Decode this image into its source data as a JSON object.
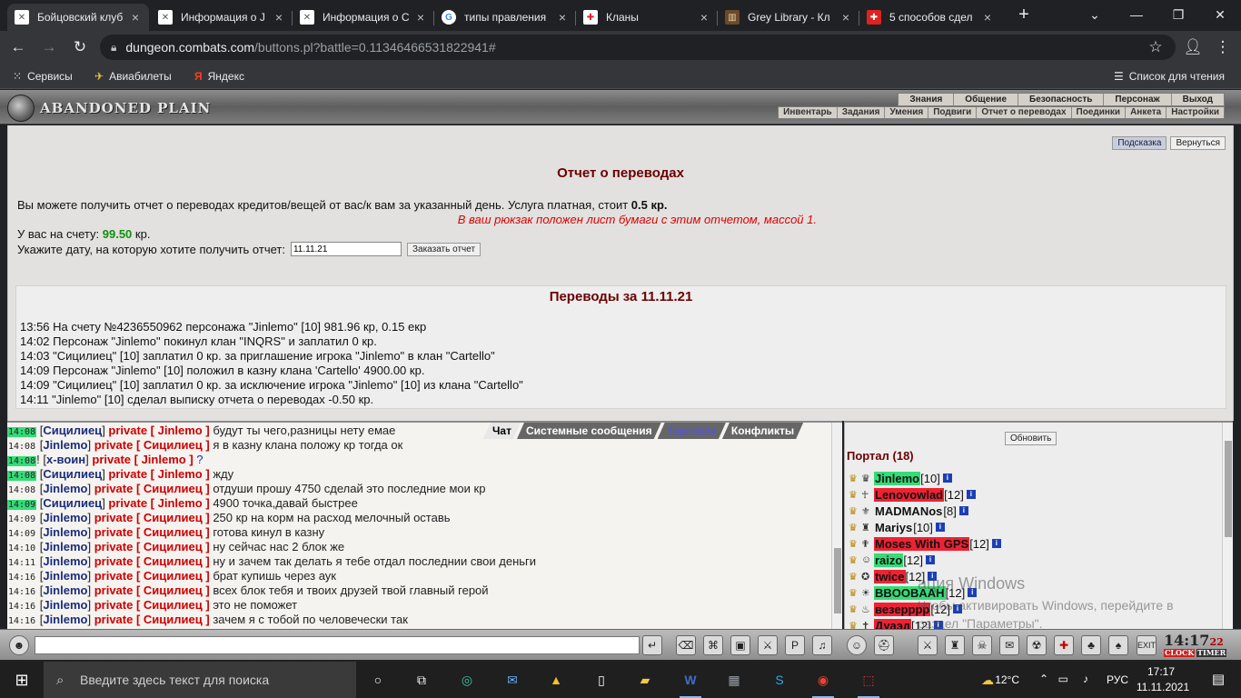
{
  "browser": {
    "tabs": [
      {
        "title": "Бойцовский клуб",
        "favicon": "x-logo-icon",
        "active": true
      },
      {
        "title": "Информация о J",
        "favicon": "x-logo-icon"
      },
      {
        "title": "Информация о С",
        "favicon": "x-logo-icon"
      },
      {
        "title": "типы правления",
        "favicon": "google-icon"
      },
      {
        "title": "Кланы",
        "favicon": "shield-icon"
      },
      {
        "title": "Grey Library - Кл",
        "favicon": "library-icon"
      },
      {
        "title": "5 способов сдел",
        "favicon": "bookmark-icon"
      }
    ],
    "new_tab": "+",
    "url_host": "dungeon.combats.com",
    "url_rest": "/buttons.pl?battle=0.11346466531822941#",
    "bookmarks": [
      {
        "label": "Сервисы",
        "icon": "apps-grid-icon"
      },
      {
        "label": "Авиабилеты",
        "icon": "plane-icon"
      },
      {
        "label": "Яндекс",
        "icon": "yandex-icon"
      }
    ],
    "reading_list": "Список для чтения"
  },
  "game_header": {
    "logo_text": "ABANDONED PLAIN",
    "menu_top": [
      "Знания",
      "Общение",
      "Безопасность",
      "Персонаж",
      "Выход"
    ],
    "menu_sub": [
      "Инвентарь",
      "Задания",
      "Умения",
      "Подвиги",
      "Отчет о переводах",
      "Поединки",
      "Анкета",
      "Настройки"
    ]
  },
  "page": {
    "hint_button": "Подсказка",
    "back_button": "Вернуться",
    "title": "Отчет о переводах",
    "desc_prefix": "Вы можете получить отчет о переводах кредитов/вещей от вас/к вам за указанный день. Услуга платная, стоит ",
    "desc_price": "0.5 кр.",
    "notice": "В ваш рюкзак положен лист бумаги с этим отчетом, массой 1.",
    "balance_label": "У вас на счету: ",
    "balance_value": "99.50",
    "balance_unit": " кр.",
    "date_label": "Укажите дату, на которую хотите получить отчет:",
    "date_value": "11.11.21",
    "order_button": "Заказать отчет",
    "report_title": "Переводы за 11.11.21",
    "report_lines": [
      "13:56 На счету №4236550962 персонажа \"Jinlemo\" [10] 981.96 кр, 0.15 екр",
      "14:02 Персонаж \"Jinlemo\" покинул клан \"INQRS\" и заплатил 0 кр.",
      "14:03 \"Сицилиец\" [10] заплатил 0 кр. за приглашение игрока \"Jinlemo\" в клан \"Cartello\"",
      "14:09 Персонаж \"Jinlemo\" [10] положил в казну клана 'Cartello' 4900.00 кр.",
      "14:09 \"Сицилиец\" [10] заплатил 0 кр. за исключение игрока \"Jinlemo\" [10] из клана \"Cartello\"",
      "14:11 \"Jinlemo\" [10] сделал выписку отчета о переводах -0.50 кр."
    ]
  },
  "chat": {
    "tabs": [
      "Чат",
      "Системные сообщения",
      "Торговля",
      "Конфликты"
    ],
    "messages": [
      {
        "time": "14:08",
        "hl": true,
        "from": "Сицилиец",
        "to": "Jinlemo",
        "text": "будут ты чего,разницы нету емае"
      },
      {
        "time": "14:08",
        "hl": false,
        "from": "Jinlemo",
        "to": "Сицилиец",
        "text": "я в казну клана положу кр тогда ок"
      },
      {
        "time": "14:08",
        "hl": true,
        "from": "x-воин",
        "to": "Jinlemo",
        "text": "?",
        "bang": true
      },
      {
        "time": "14:08",
        "hl": true,
        "from": "Сицилиец",
        "to": "Jinlemo",
        "text": "жду"
      },
      {
        "time": "14:08",
        "hl": false,
        "from": "Jinlemo",
        "to": "Сицилиец",
        "text": "отдуши прошу 4750 сделай это последние мои кр"
      },
      {
        "time": "14:09",
        "hl": true,
        "from": "Сицилиец",
        "to": "Jinlemo",
        "text": "4900 точка,давай быстрее"
      },
      {
        "time": "14:09",
        "hl": false,
        "from": "Jinlemo",
        "to": "Сицилиец",
        "text": "250 кр на корм на расход мелочный оставь"
      },
      {
        "time": "14:09",
        "hl": false,
        "from": "Jinlemo",
        "to": "Сицилиец",
        "text": "готова кинул в казну"
      },
      {
        "time": "14:10",
        "hl": false,
        "from": "Jinlemo",
        "to": "Сицилиец",
        "text": "ну сейчас нас 2 блок же"
      },
      {
        "time": "14:11",
        "hl": false,
        "from": "Jinlemo",
        "to": "Сицилиец",
        "text": "ну и зачем так делать я тебе отдал последнии свои деньги"
      },
      {
        "time": "14:16",
        "hl": false,
        "from": "Jinlemo",
        "to": "Сицилиец",
        "text": "брат купишь через аук"
      },
      {
        "time": "14:16",
        "hl": false,
        "from": "Jinlemo",
        "to": "Сицилиец",
        "text": "всех блок тебя и твоих друзей твой главный герой"
      },
      {
        "time": "14:16",
        "hl": false,
        "from": "Jinlemo",
        "to": "Сицилиец",
        "text": "это не поможет"
      },
      {
        "time": "14:16",
        "hl": false,
        "from": "Jinlemo",
        "to": "Сицилиец",
        "text": "зачем я с тобой по человечески так"
      }
    ],
    "private_word": "private"
  },
  "players": {
    "refresh_button": "Обновить",
    "room": "Портал (18)",
    "list": [
      {
        "name": "Jinlemo",
        "level": "[10]",
        "bg": "#33dd77"
      },
      {
        "name": "Lenovowlad",
        "level": "[12]",
        "bg": "#ee2233"
      },
      {
        "name": "MADMANos",
        "level": "[8]",
        "bg": ""
      },
      {
        "name": "Mariys",
        "level": "[10]",
        "bg": ""
      },
      {
        "name": "Moses With GPS",
        "level": "[12]",
        "bg": "#ee2233"
      },
      {
        "name": "raizo",
        "level": "[12]",
        "bg": "#33dd77"
      },
      {
        "name": "twice",
        "level": "[12]",
        "bg": "#ee2233"
      },
      {
        "name": "BBOOBAAH",
        "level": "[12]",
        "bg": "#33dd77"
      },
      {
        "name": "везерррр",
        "level": "[12]",
        "bg": "#ee2233"
      },
      {
        "name": "Дуаэд",
        "level": "[12]",
        "bg": "#ee2233"
      }
    ]
  },
  "watermark": {
    "line1": "ация Windows",
    "line2": "Чтобы активировать Windows, перейдите в раздел \"Параметры\"."
  },
  "clock": {
    "time": "14:17",
    "seconds": "22",
    "label1": "CLOCK",
    "label2": "TIMER",
    "exit": "EXIT"
  },
  "taskbar": {
    "search_placeholder": "Введите здесь текст для поиска",
    "weather": "12°C",
    "lang": "РУС",
    "time": "17:17",
    "date": "11.11.2021"
  }
}
